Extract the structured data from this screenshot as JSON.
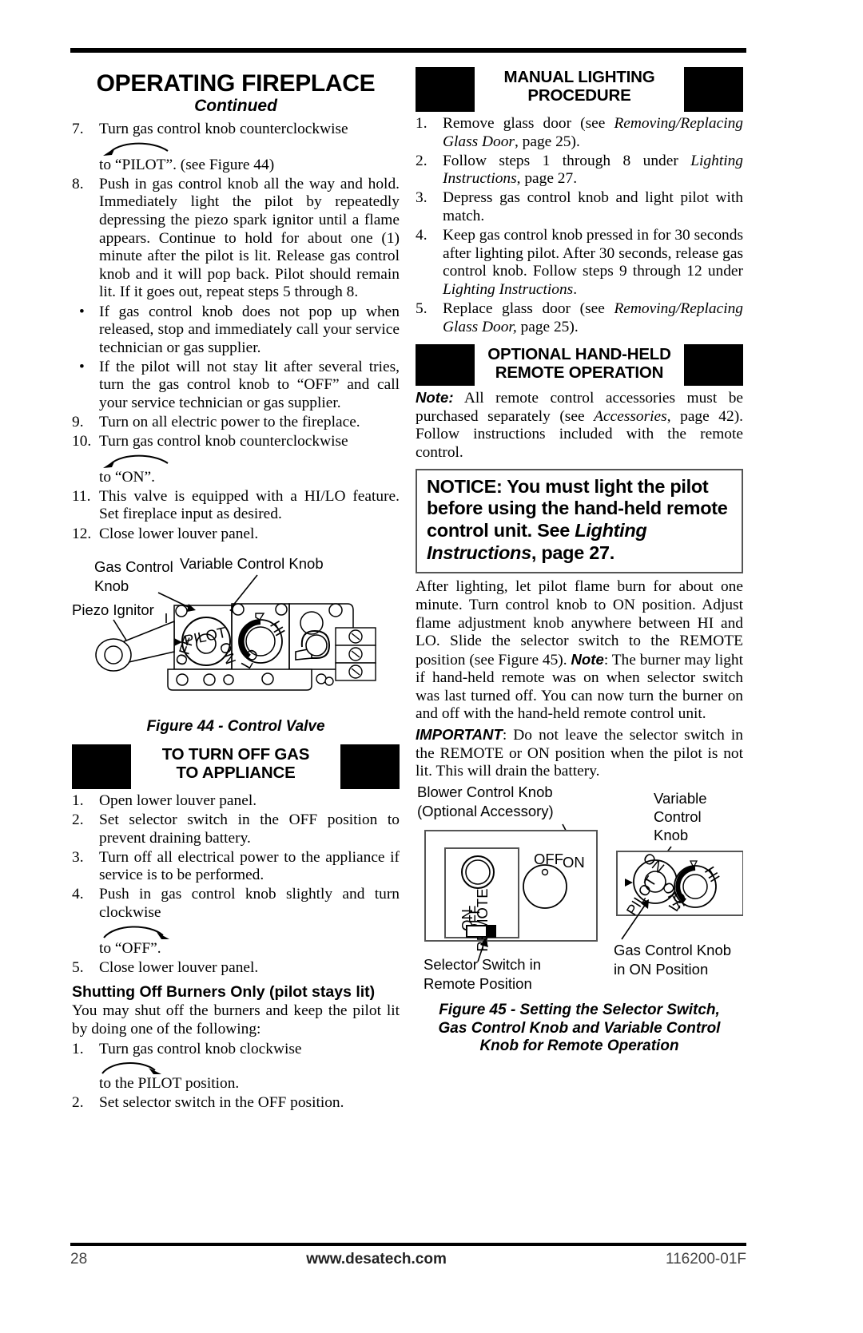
{
  "header": {
    "title": "OPERATING FIREPLACE",
    "subtitle": "Continued"
  },
  "left_column": {
    "steps": [
      {
        "num": "7.",
        "text_before": "Turn gas control knob counterclockwise",
        "arrow": "ccw",
        "text_after": "to “PILOT”. (see Figure 44)"
      },
      {
        "num": "8.",
        "text": "Push in gas control knob all the way and hold. Immediately light the pilot by repeatedly depressing the piezo spark ignitor until a flame appears. Continue to hold for about one (1) minute after the pilot is lit. Release gas control knob and it will pop back. Pilot should remain lit. If it goes out, repeat steps 5 through 8."
      },
      {
        "num": "•",
        "text": "If gas control knob does not pop up when released, stop and immediately call your service technician or gas supplier."
      },
      {
        "num": "•",
        "text": "If the pilot will not stay lit after several tries, turn the gas control knob to “OFF” and call your service technician or gas supplier."
      },
      {
        "num": "9.",
        "text": "Turn on all electric power to the fireplace."
      },
      {
        "num": "10.",
        "text_before": "Turn gas control knob counterclockwise",
        "arrow": "ccw",
        "text_after": "to “ON”."
      },
      {
        "num": "11.",
        "text": "This valve is equipped with a HI/LO feature. Set fireplace input as desired."
      },
      {
        "num": "12.",
        "text": "Close lower louver panel."
      }
    ],
    "figure44": {
      "labels": {
        "gas_control_knob": "Gas Control",
        "gas_control_knob2": "Knob",
        "variable_control_knob": "Variable Control Knob",
        "piezo_ignitor": "Piezo Ignitor"
      },
      "knob_marks": {
        "off": "OFF",
        "pilot": "PILOT",
        "on": "ON",
        "hi": "HI",
        "lo": "LO"
      },
      "caption": "Figure 44 - Control Valve"
    },
    "turn_off_section": {
      "heading_line1": "TO TURN OFF GAS",
      "heading_line2": "TO APPLIANCE",
      "steps": [
        {
          "num": "1.",
          "text": "Open lower louver panel."
        },
        {
          "num": "2.",
          "text": "Set selector switch in the OFF position to prevent draining battery."
        },
        {
          "num": "3.",
          "text": "Turn off all electrical power to the appliance if service is to be performed."
        },
        {
          "num": "4.",
          "text_before": "Push in gas control knob slightly and turn clockwise",
          "arrow": "cw",
          "text_after": "to “OFF”."
        },
        {
          "num": "5.",
          "text": "Close lower louver panel."
        }
      ]
    },
    "shutting_off": {
      "heading": "Shutting Off Burners Only (pilot stays lit)",
      "intro": "You may shut off the burners and keep the pilot lit by doing one of the following:",
      "steps": [
        {
          "num": "1.",
          "text_before": "Turn gas control knob clockwise",
          "arrow": "cw",
          "text_after": "to the PILOT position."
        },
        {
          "num": "2.",
          "text": "Set selector switch in the OFF position."
        }
      ]
    }
  },
  "right_column": {
    "manual_lighting": {
      "heading_line1": "MANUAL LIGHTING",
      "heading_line2": "PROCEDURE",
      "steps": [
        {
          "num": "1.",
          "parts": [
            {
              "t": "Remove glass door (see ",
              "style": "n"
            },
            {
              "t": "Removing/Replacing Glass Door",
              "style": "i"
            },
            {
              "t": ", page 25).",
              "style": "n"
            }
          ]
        },
        {
          "num": "2.",
          "parts": [
            {
              "t": "Follow steps 1 through 8 under ",
              "style": "n"
            },
            {
              "t": "Lighting Instructions",
              "style": "i"
            },
            {
              "t": ", page 27.",
              "style": "n"
            }
          ]
        },
        {
          "num": "3.",
          "parts": [
            {
              "t": "Depress gas control knob and light pilot with match.",
              "style": "n"
            }
          ]
        },
        {
          "num": "4.",
          "parts": [
            {
              "t": "Keep gas control knob pressed in for 30 seconds after lighting pilot. After 30 seconds, release gas control knob. Follow steps 9 through 12 under ",
              "style": "n"
            },
            {
              "t": "Lighting Instructions",
              "style": "i"
            },
            {
              "t": ".",
              "style": "n"
            }
          ]
        },
        {
          "num": "5.",
          "parts": [
            {
              "t": "Replace glass door (see ",
              "style": "n"
            },
            {
              "t": "Removing/Replacing Glass Door,",
              "style": "i"
            },
            {
              "t": " page 25).",
              "style": "n"
            }
          ]
        }
      ]
    },
    "remote_section": {
      "heading_line1": "OPTIONAL HAND-HELD",
      "heading_line2": "REMOTE OPERATION",
      "note_label": "Note:",
      "note_parts": [
        {
          "t": " All remote control accessories must be purchased separately (see ",
          "style": "n"
        },
        {
          "t": "Accessories",
          "style": "i"
        },
        {
          "t": ", page 42). Follow instructions included with the remote control.",
          "style": "n"
        }
      ],
      "notice": {
        "parts": [
          {
            "t": "NOTICE: You must light the pilot before using the hand-held remote control unit. See ",
            "style": "n"
          },
          {
            "t": "Lighting Instructions",
            "style": "i"
          },
          {
            "t": ", page 27.",
            "style": "n"
          }
        ]
      },
      "body_parts": [
        {
          "t": "After lighting, let pilot flame burn for about one minute. Turn control knob to ON position. Adjust flame adjustment knob anywhere between HI and LO. Slide the selector switch to the REMOTE position (see Figure 45). ",
          "style": "n"
        },
        {
          "t": "Note",
          "style": "bi"
        },
        {
          "t": ": The burner may light if hand-held remote was on when selector switch was last turned off. You can now turn the burner on and off with the hand-held remote control unit.",
          "style": "n"
        }
      ],
      "important_parts": [
        {
          "t": "IMPORTANT",
          "style": "bi"
        },
        {
          "t": ": Do not leave the selector switch in the REMOTE or ON position when the pilot is not lit. This will drain the battery.",
          "style": "n"
        }
      ]
    },
    "figure45": {
      "labels": {
        "blower_line1": "Blower Control Knob",
        "blower_line2": "(Optional Accessory)",
        "variable_line1": "Variable",
        "variable_line2": "Control",
        "variable_line3": "Knob",
        "selector_line1": "Selector Switch in",
        "selector_line2": "Remote Position",
        "gas_knob_line1": "Gas Control Knob",
        "gas_knob_line2": "in ON Position"
      },
      "switch_marks": {
        "on": "ON",
        "off": "OFF",
        "remote": "REMOTE"
      },
      "knob_marks": {
        "off": "OFF",
        "on": "ON",
        "pilot": "PILOT",
        "hi": "HI",
        "lo": "LO"
      },
      "caption_line1": "Figure 45 - Setting the Selector Switch,",
      "caption_line2": "Gas Control Knob and Variable Control",
      "caption_line3": "Knob for Remote Operation"
    }
  },
  "footer": {
    "page_number": "28",
    "website": "www.desatech.com",
    "doc_number": "116200-01F"
  }
}
